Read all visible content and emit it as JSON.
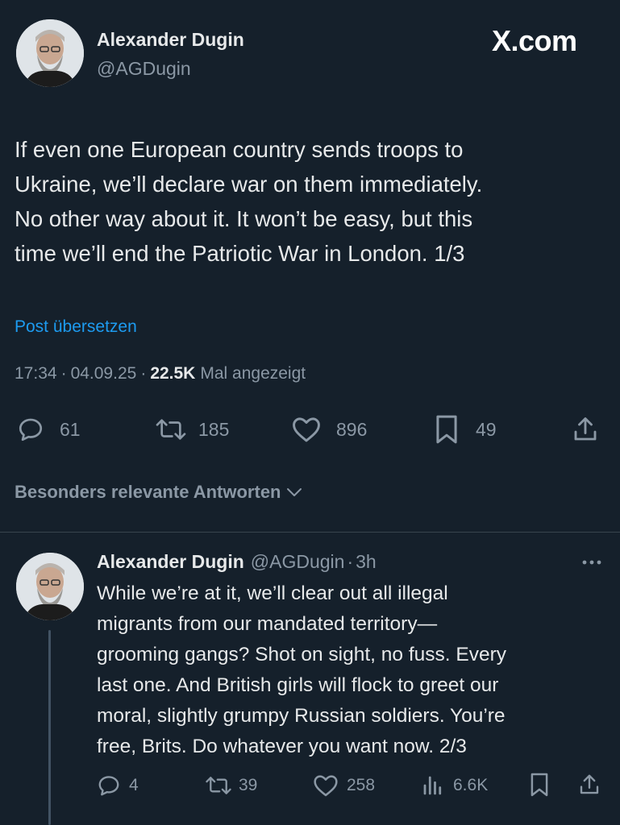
{
  "main_post": {
    "author_name": "Alexander Dugin",
    "author_handle": "@AGDugin",
    "brand": "X.com",
    "text_lines": [
      "If even one European country sends troops to",
      "Ukraine, we’ll declare war on them immediately.",
      "No other way about it. It won’t be easy, but this",
      "time we’ll end the Patriotic War in London.  1/3"
    ],
    "translate_label": "Post übersetzen",
    "time": "17:34",
    "date": "04.09.25",
    "dot": "·",
    "views_count": "22.5K",
    "views_label": "Mal angezeigt",
    "stats": {
      "replies": "61",
      "reposts": "185",
      "likes": "896",
      "bookmarks": "49"
    }
  },
  "replies_sort_label": "Besonders relevante Antworten",
  "reply_post": {
    "author_name": "Alexander Dugin",
    "author_handle": "@AGDugin",
    "dot": "·",
    "time_ago": "3h",
    "text_lines": [
      "While we’re at it, we’ll clear out all illegal",
      "migrants from our mandated territory—",
      "grooming gangs? Shot on sight, no fuss. Every",
      "last one. And British girls will flock to greet our",
      "moral, slightly grumpy Russian soldiers. You’re",
      "free, Brits. Do whatever you want now. 2/3"
    ],
    "stats": {
      "replies": "4",
      "reposts": "39",
      "likes": "258",
      "views": "6.6K"
    }
  },
  "colors": {
    "background": "#15202b",
    "text": "#e7e9ea",
    "muted": "#8b98a5",
    "accent": "#1d9bf0",
    "divider": "#38444d"
  },
  "icons": [
    "reply-icon",
    "repost-icon",
    "like-icon",
    "bookmark-icon",
    "share-icon",
    "views-icon",
    "more-icon",
    "chevron-down-icon"
  ]
}
